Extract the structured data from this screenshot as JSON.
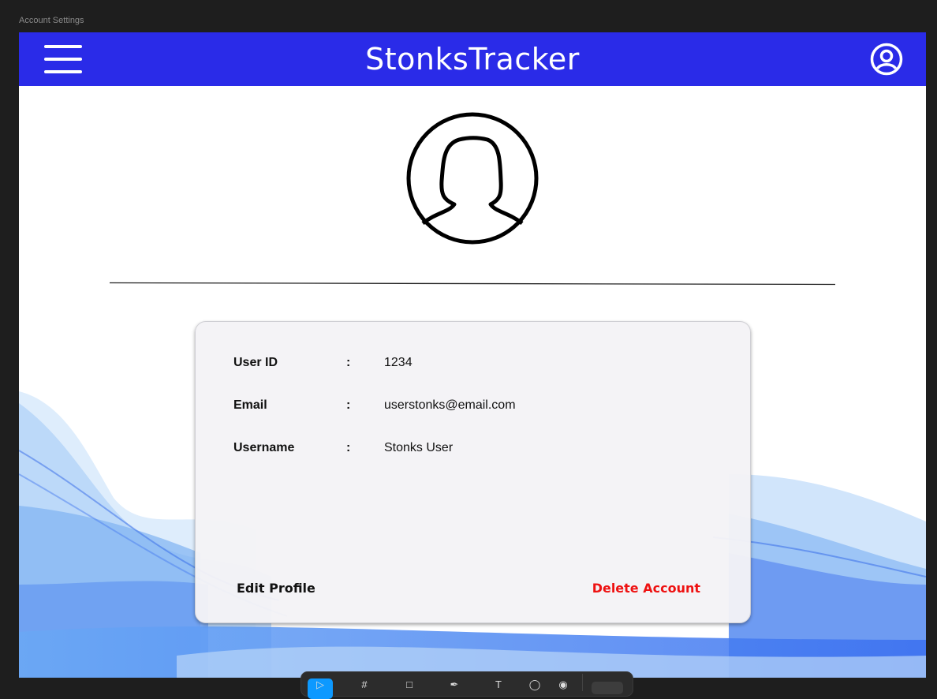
{
  "frame": {
    "label": "Account Settings"
  },
  "header": {
    "title": "StonksTracker",
    "menu_icon": "hamburger-menu-icon",
    "profile_icon": "user-circle-icon",
    "background": "#2a2be8"
  },
  "profile": {
    "avatar_icon": "female-user-avatar-icon"
  },
  "details": {
    "rows": [
      {
        "label": "User ID",
        "separator": ":",
        "value": "1234"
      },
      {
        "label": "Email",
        "separator": ":",
        "value": "userstonks@email.com"
      },
      {
        "label": "Username",
        "separator": ":",
        "value": "Stonks User"
      }
    ]
  },
  "actions": {
    "edit_label": "Edit Profile",
    "delete_label": "Delete Account",
    "delete_color": "#ee1111"
  },
  "toolbar": {
    "tools": [
      "move-tool-icon",
      "frame-tool-icon",
      "rectangle-tool-icon",
      "pen-tool-icon",
      "text-tool-icon",
      "comment-tool-icon",
      "components-tool-icon"
    ],
    "accent": "#0d99ff"
  }
}
